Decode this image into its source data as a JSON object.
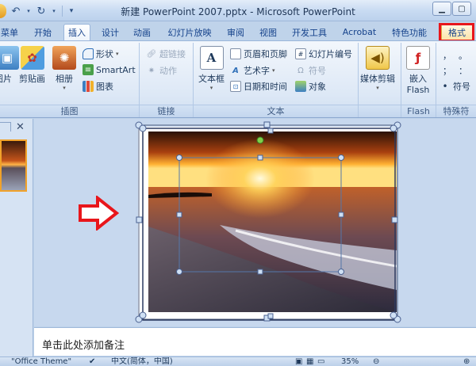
{
  "window": {
    "title": "新建 PowerPoint 2007.pptx - Microsoft PowerPoint",
    "minimize_icon": "minimize-icon",
    "maximize_icon": "restore-icon"
  },
  "qat": {
    "undo_icon": "undo-icon",
    "redo_icon": "redo-icon",
    "dropdown_icon": "customize-dropdown-icon"
  },
  "tabs": [
    {
      "label": "菜单",
      "active": false
    },
    {
      "label": "开始",
      "active": false
    },
    {
      "label": "插入",
      "active": true
    },
    {
      "label": "设计",
      "active": false
    },
    {
      "label": "动画",
      "active": false
    },
    {
      "label": "幻灯片放映",
      "active": false
    },
    {
      "label": "审阅",
      "active": false
    },
    {
      "label": "视图",
      "active": false
    },
    {
      "label": "开发工具",
      "active": false
    },
    {
      "label": "Acrobat",
      "active": false
    },
    {
      "label": "特色功能",
      "active": false
    },
    {
      "label": "格式",
      "active": false,
      "highlighted": true
    }
  ],
  "ribbon": {
    "illustrations": {
      "label": "插图",
      "picture": "图片",
      "clipart": "剪贴画",
      "album": "相册",
      "shapes": "形状",
      "smartart": "SmartArt",
      "chart": "图表"
    },
    "links": {
      "label": "链接",
      "hyperlink": "超链接",
      "action": "动作"
    },
    "text": {
      "label": "文本",
      "textbox": "文本框",
      "header_footer": "页眉和页脚",
      "wordart": "艺术字",
      "datetime": "日期和时间",
      "slide_number": "幻灯片编号",
      "symbol": "符号",
      "object": "对象"
    },
    "media": {
      "media_clips": "媒体剪辑"
    },
    "flash": {
      "label": "Flash",
      "embed": "嵌入",
      "flash": "Flash"
    },
    "special": {
      "label": "特殊符",
      "symbol": "符号",
      "chars": [
        "，",
        "。",
        "；",
        "："
      ]
    }
  },
  "notes": {
    "placeholder": "单击此处添加备注"
  },
  "statusbar": {
    "theme": "\"Office Theme\"",
    "language": "中文(简体，中国)",
    "zoom": "35%"
  },
  "colors": {
    "accent_red": "#e8161b",
    "ribbon_blue": "#bfd3ea"
  }
}
